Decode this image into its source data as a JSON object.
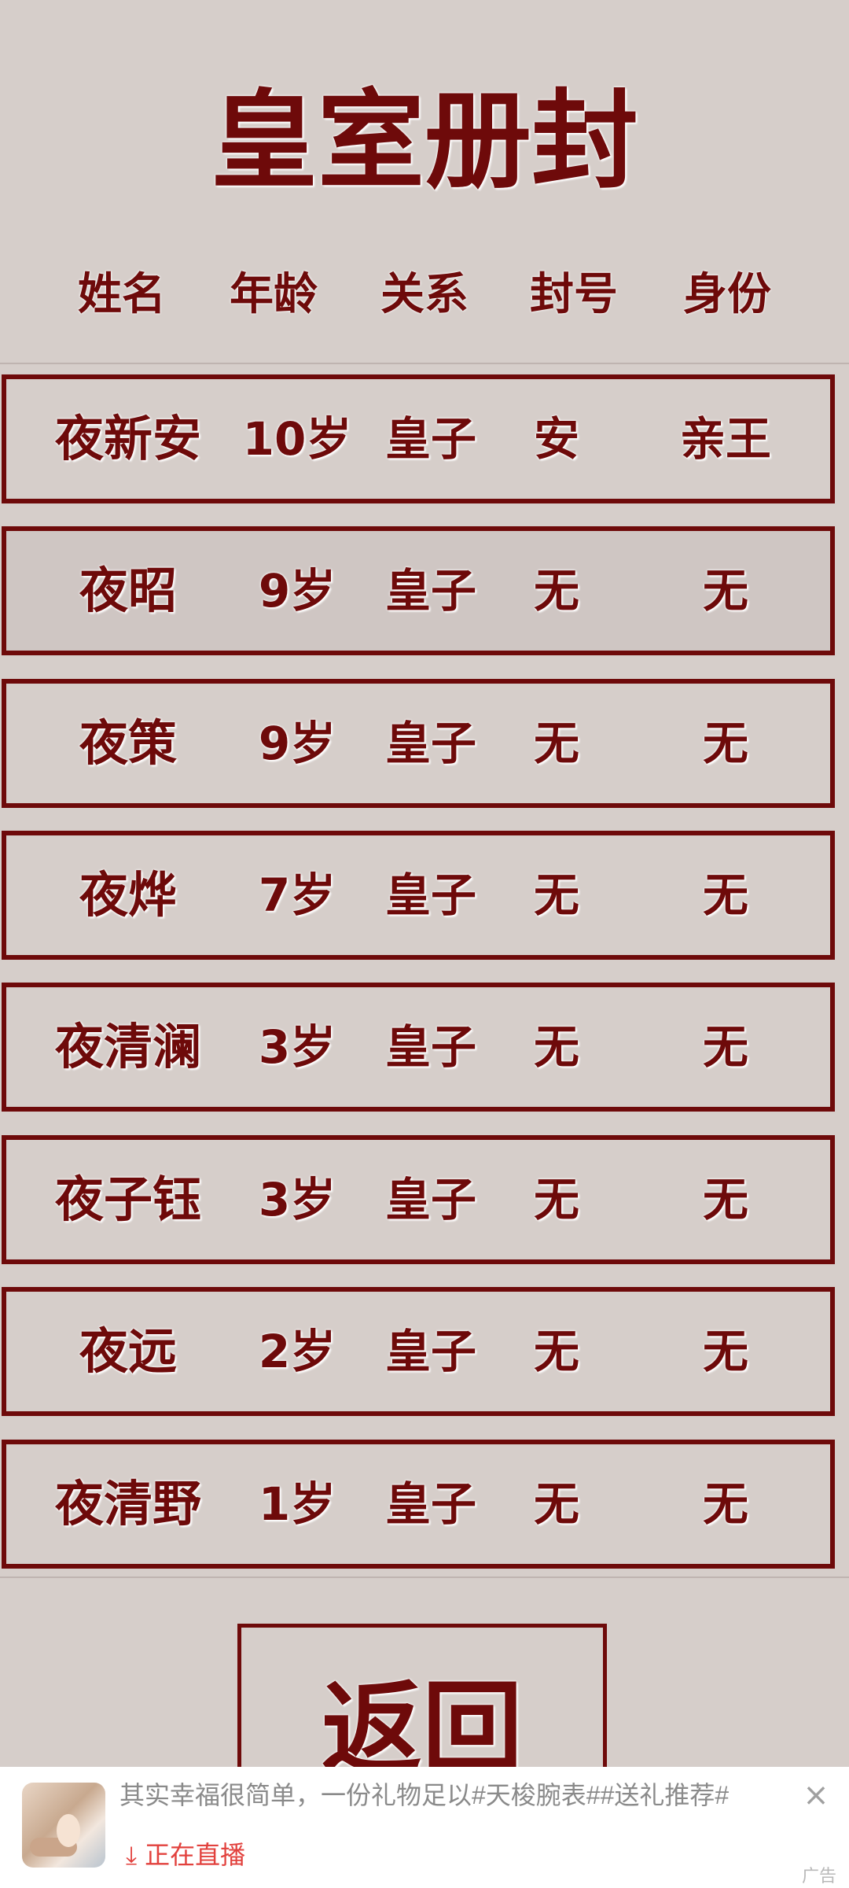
{
  "page": {
    "title": "皇室册封"
  },
  "table": {
    "columns": [
      "姓名",
      "年龄",
      "关系",
      "封号",
      "身份"
    ],
    "rows": [
      {
        "name": "夜新安",
        "age": "10岁",
        "relation": "皇子",
        "title": "安",
        "status": "亲王"
      },
      {
        "name": "夜昭",
        "age": "9岁",
        "relation": "皇子",
        "title": "无",
        "status": "无"
      },
      {
        "name": "夜策",
        "age": "9岁",
        "relation": "皇子",
        "title": "无",
        "status": "无"
      },
      {
        "name": "夜烨",
        "age": "7岁",
        "relation": "皇子",
        "title": "无",
        "status": "无"
      },
      {
        "name": "夜清澜",
        "age": "3岁",
        "relation": "皇子",
        "title": "无",
        "status": "无"
      },
      {
        "name": "夜子钰",
        "age": "3岁",
        "relation": "皇子",
        "title": "无",
        "status": "无"
      },
      {
        "name": "夜远",
        "age": "2岁",
        "relation": "皇子",
        "title": "无",
        "status": "无"
      },
      {
        "name": "夜清野",
        "age": "1岁",
        "relation": "皇子",
        "title": "无",
        "status": "无"
      }
    ]
  },
  "back_button": {
    "label": "返回"
  },
  "ad": {
    "text": "其实幸福很简单，一份礼物足以#天梭腕表##送礼推荐#",
    "live_label": "正在直播",
    "live_icon": "download-arrow-icon",
    "close_icon": "close-icon",
    "corner_label": "广告"
  },
  "colors": {
    "background": "#d6ceca",
    "accent": "#6e0a0a",
    "ad_live": "#e2413d"
  }
}
